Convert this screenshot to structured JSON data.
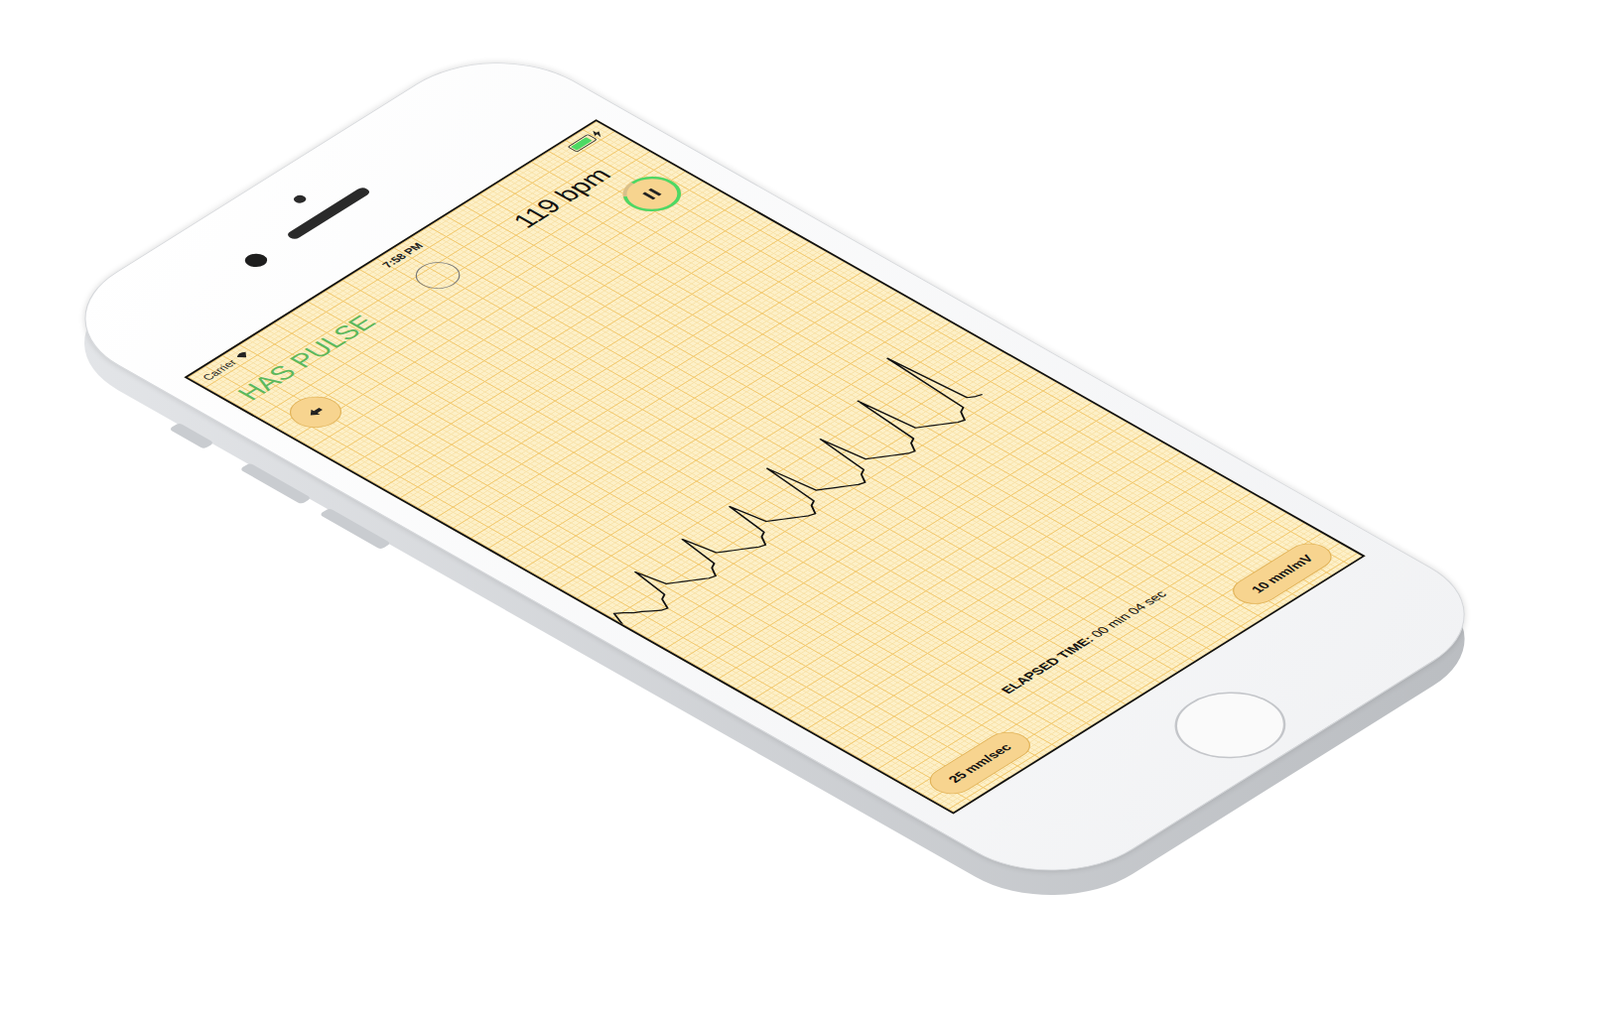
{
  "status_bar": {
    "carrier": "Carrier",
    "time": "7:58 PM",
    "battery_level": 0.9,
    "charging": true
  },
  "pulse_status": "HAS PULSE",
  "heart_rate": "119 bpm",
  "beat_indicator": {
    "on": false
  },
  "recording": {
    "active": true,
    "level": 0.85
  },
  "elapsed": {
    "label": "ELAPSED TIME:",
    "value": "00 min 04 sec"
  },
  "paper_speed": "25 mm/sec",
  "gain": "10 mm/mV",
  "ecg": {
    "values": [
      0,
      0.15,
      0.1,
      0.04,
      0,
      -0.05,
      -0.1,
      -0.12,
      0,
      0.03,
      0.42,
      0.12,
      0.08,
      0.04,
      0,
      -0.04,
      -0.08,
      -0.1,
      0,
      0.03,
      0.45,
      0.12,
      0.08,
      0.04,
      0,
      -0.04,
      -0.08,
      -0.1,
      0,
      0.03,
      0.48,
      0.12,
      0.08,
      0.04,
      0,
      -0.04,
      -0.08,
      -0.1,
      0,
      0.03,
      0.62,
      0.12,
      0.08,
      0.04,
      0,
      -0.04,
      -0.08,
      -0.1,
      0,
      0.03,
      0.58,
      0.12,
      0.08,
      0.04,
      0,
      -0.04,
      -0.08,
      -0.1,
      0,
      0.03,
      0.72,
      0.12,
      0.08,
      0.04,
      0,
      -0.04,
      -0.08,
      -0.1,
      0,
      0.03,
      0.95,
      0.1,
      0.06,
      0.04
    ]
  }
}
